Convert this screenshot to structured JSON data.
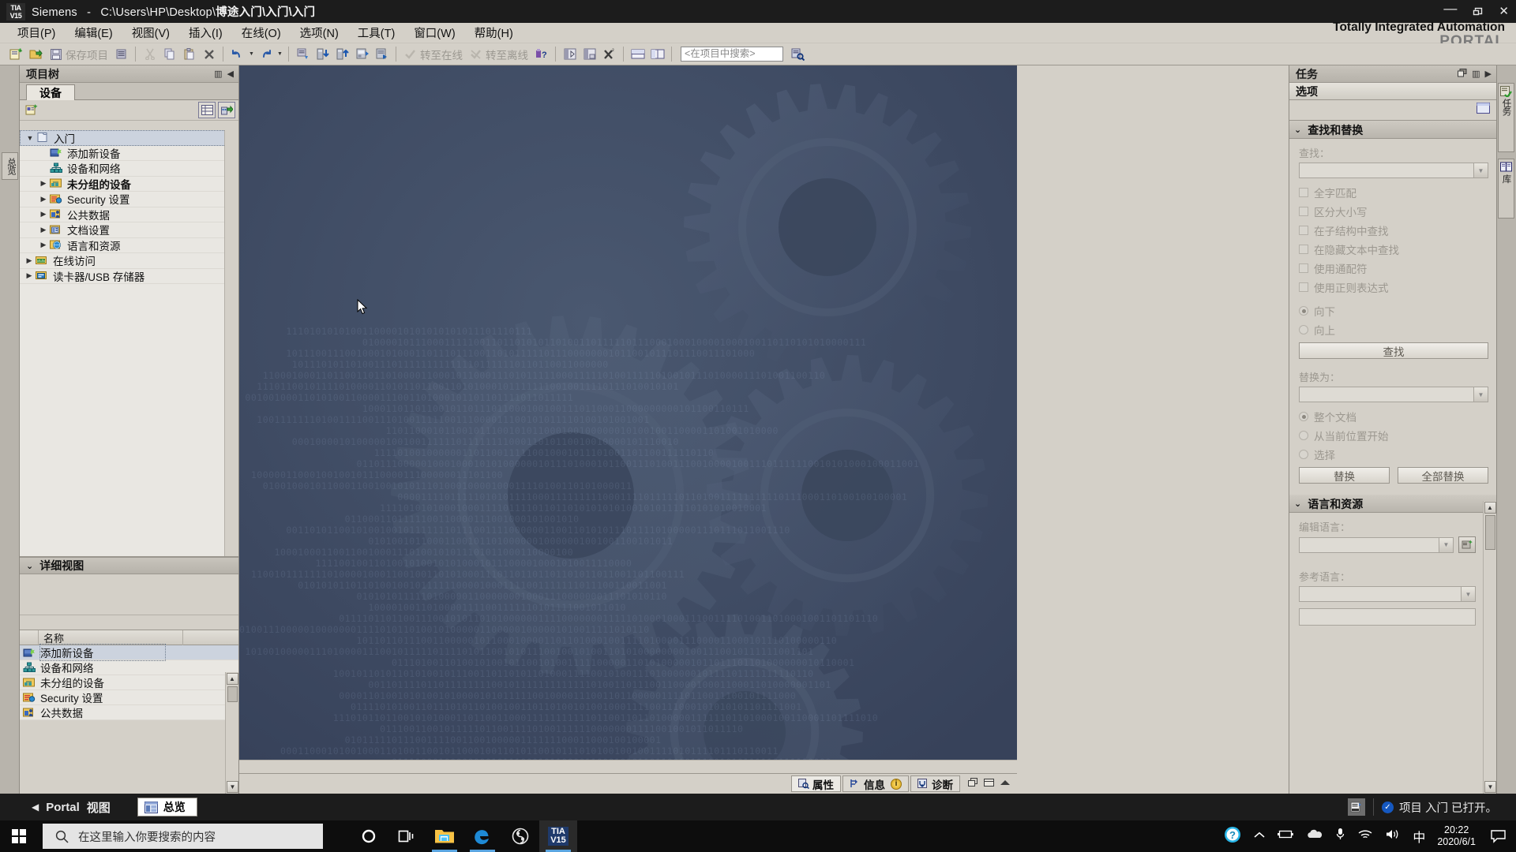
{
  "titlebar": {
    "logo_line1": "TIA",
    "logo_line2": "V15",
    "app_name": "Siemens",
    "separator": "-",
    "path": "C:\\Users\\HP\\Desktop\\",
    "project": "博途入门\\入门\\入门",
    "minimize": "—",
    "maximize": "❐",
    "close": "✕"
  },
  "menu": {
    "items": [
      {
        "label": "项目(P)"
      },
      {
        "label": "编辑(E)"
      },
      {
        "label": "视图(V)"
      },
      {
        "label": "插入(I)"
      },
      {
        "label": "在线(O)"
      },
      {
        "label": "选项(N)"
      },
      {
        "label": "工具(T)"
      },
      {
        "label": "窗口(W)"
      },
      {
        "label": "帮助(H)"
      }
    ],
    "brand_line1": "Totally Integrated Automation",
    "brand_line2": "PORTAL"
  },
  "toolbar": {
    "save_label": "保存项目",
    "goto_online": "转至在线",
    "goto_offline": "转至离线",
    "search_placeholder": "<在项目中搜索>"
  },
  "tree_panel": {
    "title": "项目树",
    "tab_label": "设备",
    "nodes": [
      {
        "label": "入门",
        "level": 0,
        "arrow": "▼",
        "icon": "folder-project-icon",
        "selected": true,
        "bold": false
      },
      {
        "label": "添加新设备",
        "level": 1,
        "arrow": "",
        "icon": "add-device-icon",
        "selected": false,
        "bold": false
      },
      {
        "label": "设备和网络",
        "level": 1,
        "arrow": "",
        "icon": "devices-networks-icon",
        "selected": false,
        "bold": false
      },
      {
        "label": "未分组的设备",
        "level": 1,
        "arrow": "▶",
        "icon": "ungrouped-devices-icon",
        "selected": false,
        "bold": true
      },
      {
        "label": "Security 设置",
        "level": 1,
        "arrow": "▶",
        "icon": "security-settings-icon",
        "selected": false,
        "bold": false
      },
      {
        "label": "公共数据",
        "level": 1,
        "arrow": "▶",
        "icon": "common-data-icon",
        "selected": false,
        "bold": false
      },
      {
        "label": "文档设置",
        "level": 1,
        "arrow": "▶",
        "icon": "document-settings-icon",
        "selected": false,
        "bold": false
      },
      {
        "label": "语言和资源",
        "level": 1,
        "arrow": "▶",
        "icon": "languages-resources-icon",
        "selected": false,
        "bold": false
      },
      {
        "label": "在线访问",
        "level": 0,
        "arrow": "▶",
        "icon": "online-access-icon",
        "selected": false,
        "bold": false
      },
      {
        "label": "读卡器/USB 存储器",
        "level": 0,
        "arrow": "▶",
        "icon": "card-reader-icon",
        "selected": false,
        "bold": false
      }
    ]
  },
  "detail_view": {
    "title": "详细视图",
    "column_name": "名称",
    "rows": [
      {
        "label": "添加新设备",
        "icon": "add-device-icon",
        "selected": true
      },
      {
        "label": "设备和网络",
        "icon": "devices-networks-icon",
        "selected": false
      },
      {
        "label": "未分组的设备",
        "icon": "ungrouped-devices-icon",
        "selected": false
      },
      {
        "label": "Security 设置",
        "icon": "security-settings-icon",
        "selected": false
      },
      {
        "label": "公共数据",
        "icon": "common-data-icon",
        "selected": false
      }
    ]
  },
  "left_strip": {
    "tab_label": "总览"
  },
  "canvas": {
    "bottom_tabs": [
      {
        "label": "属性",
        "icon": "properties-icon",
        "active": true
      },
      {
        "label": "信息",
        "icon": "info-icon",
        "active": false
      },
      {
        "label": "诊断",
        "icon": "diagnostics-icon",
        "active": false
      }
    ],
    "info_badge": "i"
  },
  "task_panel": {
    "title": "任务",
    "subtitle": "选项",
    "sections": [
      {
        "title": "查找和替换",
        "find_label": "查找：",
        "find_value": "",
        "checkboxes": [
          {
            "label": "全字匹配",
            "checked": false
          },
          {
            "label": "区分大小写",
            "checked": false
          },
          {
            "label": "在子结构中查找",
            "checked": false
          },
          {
            "label": "在隐藏文本中查找",
            "checked": false
          },
          {
            "label": "使用通配符",
            "checked": false
          },
          {
            "label": "使用正则表达式",
            "checked": false
          }
        ],
        "direction_radios": [
          {
            "label": "向下",
            "checked": true
          },
          {
            "label": "向上",
            "checked": false
          }
        ],
        "find_button": "查找",
        "replace_label": "替换为：",
        "replace_value": "",
        "scope_radios": [
          {
            "label": "整个文档",
            "checked": true
          },
          {
            "label": "从当前位置开始",
            "checked": false
          },
          {
            "label": "选择",
            "checked": false
          }
        ],
        "replace_button": "替换",
        "replace_all_button": "全部替换"
      },
      {
        "title": "语言和资源",
        "edit_lang_label": "编辑语言：",
        "edit_lang_value": "",
        "ref_lang_label": "参考语言：",
        "ref_lang_value": ""
      }
    ],
    "vtabs": [
      {
        "label": "任务",
        "icon": "tasks-icon"
      },
      {
        "label": "库",
        "icon": "libraries-icon"
      }
    ]
  },
  "app_status": {
    "portal_arrow": "◀",
    "portal_label_bold": "Portal",
    "portal_label": "视图",
    "overview_label": "总览",
    "message": "项目 入门 已打开。",
    "check": "✓"
  },
  "taskbar": {
    "search_placeholder": "在这里输入你要搜索的内容",
    "apps": [
      {
        "name": "cortana-icon",
        "active": false
      },
      {
        "name": "task-view-icon",
        "active": false
      },
      {
        "name": "file-explorer-icon",
        "active": true
      },
      {
        "name": "edge-icon",
        "active": true
      },
      {
        "name": "obs-icon",
        "active": false
      },
      {
        "name": "tia-portal-icon",
        "active": true
      }
    ],
    "tia_icon_line1": "TIA",
    "tia_icon_line2": "V15",
    "tray": {
      "ime": "中",
      "time": "20:22",
      "date": "2020/6/1"
    }
  },
  "colors": {
    "canvas_bg": "#3e4a5e",
    "chrome": "#d4d0c8",
    "titlebar": "#1c1c1c",
    "accent": "#1558c0"
  }
}
